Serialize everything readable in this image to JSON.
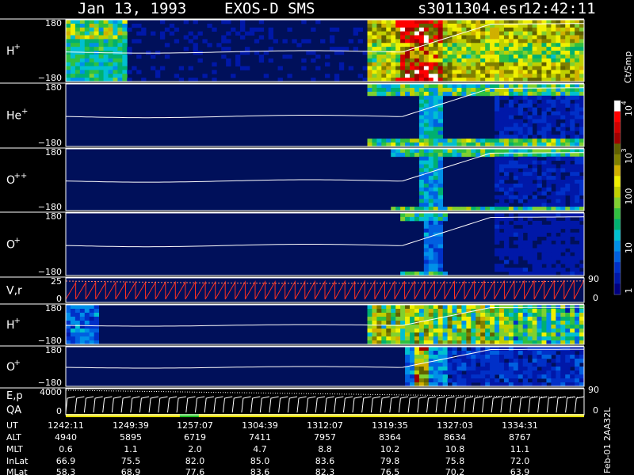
{
  "header": {
    "date": "Jan 13, 1993",
    "instrument": "EXOS-D SMS",
    "file": "s3011304.esr",
    "time": "12:42:11"
  },
  "colorbar": {
    "unit_label": "Ct/Smp",
    "ticks": [
      "1",
      "10",
      "100",
      "10",
      "10"
    ],
    "tick_superscripts": [
      "",
      "",
      "",
      "3",
      "4"
    ],
    "colors": [
      "#000080",
      "#0018a8",
      "#0030c8",
      "#0060e0",
      "#0090e8",
      "#00c0d0",
      "#00b070",
      "#30c040",
      "#80d030",
      "#c0d000",
      "#f0f000",
      "#d0b000",
      "#808000",
      "#606000",
      "#a00000",
      "#d00000",
      "#ff0000",
      "#ffffff"
    ]
  },
  "footer": {
    "side_label": "Feb-01 2AA32L",
    "row_labels": [
      "UT",
      "ALT",
      "MLT",
      "InLat",
      "MLat"
    ],
    "columns": [
      {
        "ut": "1242:11",
        "alt": "4940",
        "mlt": "0.6",
        "inlat": "66.9",
        "mlat": "58.3"
      },
      {
        "ut": "1249:39",
        "alt": "5895",
        "mlt": "1.1",
        "inlat": "75.5",
        "mlat": "68.9"
      },
      {
        "ut": "1257:07",
        "alt": "6719",
        "mlt": "2.0",
        "inlat": "82.0",
        "mlat": "77.6"
      },
      {
        "ut": "1304:39",
        "alt": "7411",
        "mlt": "4.7",
        "inlat": "85.0",
        "mlat": "83.6"
      },
      {
        "ut": "1312:07",
        "alt": "7957",
        "mlt": "8.8",
        "inlat": "83.6",
        "mlat": "82.3"
      },
      {
        "ut": "1319:35",
        "alt": "8364",
        "mlt": "10.2",
        "inlat": "79.8",
        "mlat": "76.5"
      },
      {
        "ut": "1327:03",
        "alt": "8634",
        "mlt": "10.8",
        "inlat": "75.8",
        "mlat": "70.2"
      },
      {
        "ut": "1334:31",
        "alt": "8767",
        "mlt": "11.1",
        "inlat": "72.0",
        "mlat": "63.9"
      }
    ]
  },
  "chart_data": {
    "type": "heatmap",
    "x_time_ticks": [
      "1242:11",
      "1249:39",
      "1257:07",
      "1304:39",
      "1312:07",
      "1319:35",
      "1327:03",
      "1334:31"
    ],
    "panels": [
      {
        "label": "H",
        "sup": "+",
        "ylim": [
          -180,
          180
        ],
        "ytick_top": "180",
        "ytick_bottom": "−180",
        "kind": "h_main"
      },
      {
        "label": "He",
        "sup": "+",
        "ylim": [
          -180,
          180
        ],
        "ytick_top": "180",
        "ytick_bottom": "−180",
        "kind": "he"
      },
      {
        "label": "O",
        "sup": "++",
        "ylim": [
          -180,
          180
        ],
        "ytick_top": "180",
        "ytick_bottom": "−180",
        "kind": "opp"
      },
      {
        "label": "O",
        "sup": "+",
        "ylim": [
          -180,
          180
        ],
        "ytick_top": "180",
        "ytick_bottom": "−180",
        "kind": "op"
      },
      {
        "label": "V,r",
        "sup": "",
        "kind": "vr",
        "ytick_top": "25",
        "ytick_bottom": "0",
        "right_top": "90",
        "right_bottom": "0"
      },
      {
        "label": "H",
        "sup": "+",
        "ylim": [
          -180,
          180
        ],
        "ytick_top": "180",
        "ytick_bottom": "−180",
        "kind": "h2"
      },
      {
        "label": "O",
        "sup": "+",
        "ylim": [
          -180,
          180
        ],
        "ytick_top": "180",
        "ytick_bottom": "−180",
        "kind": "o2"
      },
      {
        "label": "E,p",
        "label2": "QA",
        "kind": "ep",
        "ytick_top": "4000",
        "ytick_bottom": "0",
        "right_top": "90",
        "right_bottom": "0"
      }
    ]
  }
}
